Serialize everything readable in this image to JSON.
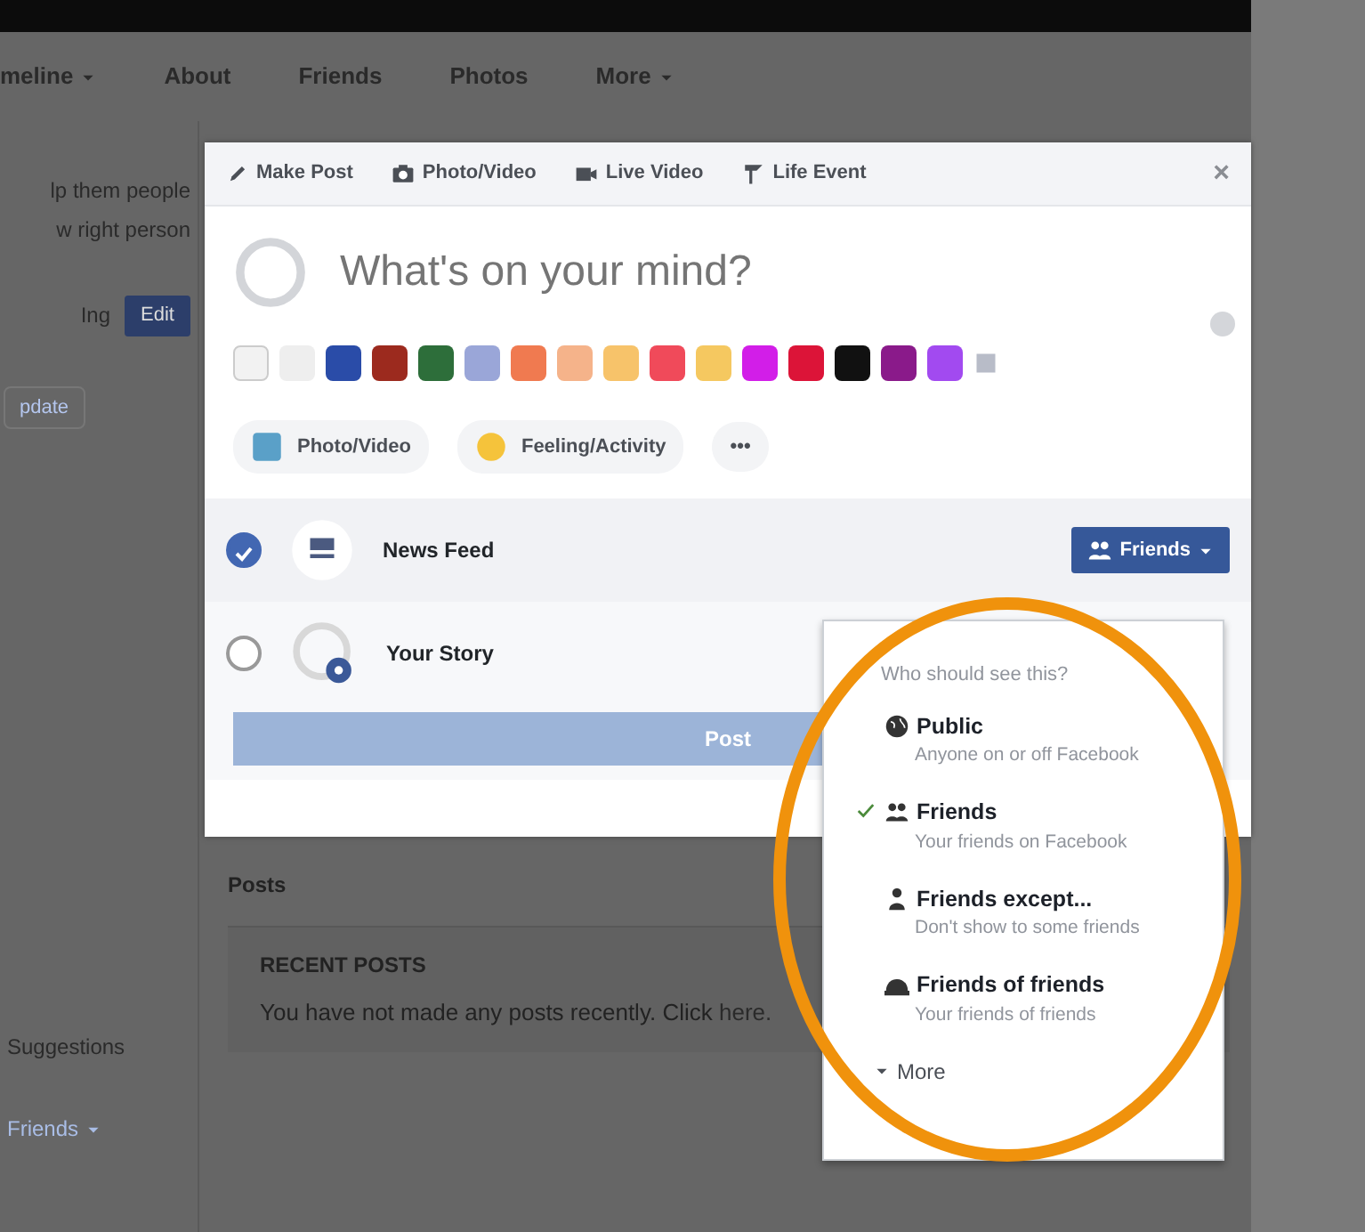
{
  "profile_nav": [
    {
      "label": "meline",
      "caret": true
    },
    {
      "label": "About",
      "caret": false
    },
    {
      "label": "Friends",
      "caret": false
    },
    {
      "label": "Photos",
      "caret": false
    },
    {
      "label": "More",
      "caret": true
    }
  ],
  "sidebar": {
    "lines": [
      "lp them people",
      "w right person"
    ],
    "prompt": "Ing",
    "edit_button": "Edit",
    "link_button": "pdate",
    "lower_label": "Suggestions",
    "friends_link": "Friends"
  },
  "feed": {
    "posts_heading": "Posts",
    "recent_title": "RECENT POSTS",
    "recent_text": "You have not made any posts recently. Click",
    "recent_link": "here."
  },
  "composer": {
    "tabs": [
      {
        "label": "Make Post"
      },
      {
        "label": "Photo/Video"
      },
      {
        "label": "Live Video"
      },
      {
        "label": "Life Event"
      }
    ],
    "close_label": "×",
    "placeholder": "What's on your mind?",
    "backgrounds": [
      {
        "kind": "none",
        "color": "#f2f2f2"
      },
      {
        "kind": "plain",
        "color": "#eeeeee"
      },
      {
        "kind": "plain",
        "color": "#2a4ca8"
      },
      {
        "kind": "plain",
        "color": "#9c2a1e"
      },
      {
        "kind": "plain",
        "color": "#2d6e3a"
      },
      {
        "kind": "plain",
        "color": "#9aa6d8"
      },
      {
        "kind": "plain",
        "color": "#f07a50"
      },
      {
        "kind": "plain",
        "color": "#f5b38a"
      },
      {
        "kind": "plain",
        "color": "#f7c36a"
      },
      {
        "kind": "plain",
        "color": "#f04a5a"
      },
      {
        "kind": "plain",
        "color": "#f5c860"
      },
      {
        "kind": "plain",
        "color": "#d21ee8"
      },
      {
        "kind": "plain",
        "color": "#dc1438"
      },
      {
        "kind": "plain",
        "color": "#111111"
      },
      {
        "kind": "plain",
        "color": "#8a1a8a"
      },
      {
        "kind": "plain",
        "color": "#a24af0"
      },
      {
        "kind": "more",
        "color": "#b8bcc8"
      }
    ],
    "actions": [
      {
        "label": "Photo/Video"
      },
      {
        "label": "Feeling/Activity"
      },
      {
        "label": "•••"
      }
    ],
    "destinations": [
      {
        "label": "News Feed",
        "checked": true,
        "kind": "feed"
      },
      {
        "label": "Your Story",
        "checked": false,
        "kind": "story"
      }
    ],
    "audience_button": "Friends",
    "post_button": "Post"
  },
  "audience_menu": {
    "heading": "Who should see this?",
    "options": [
      {
        "title": "Public",
        "subtitle": "Anyone on or off Facebook",
        "selected": false
      },
      {
        "title": "Friends",
        "subtitle": "Your friends on Facebook",
        "selected": true
      },
      {
        "title": "Friends except...",
        "subtitle": "Don't show to some friends",
        "selected": false
      },
      {
        "title": "Friends of friends",
        "subtitle": "Your friends of friends",
        "selected": false
      }
    ],
    "more": "More"
  }
}
